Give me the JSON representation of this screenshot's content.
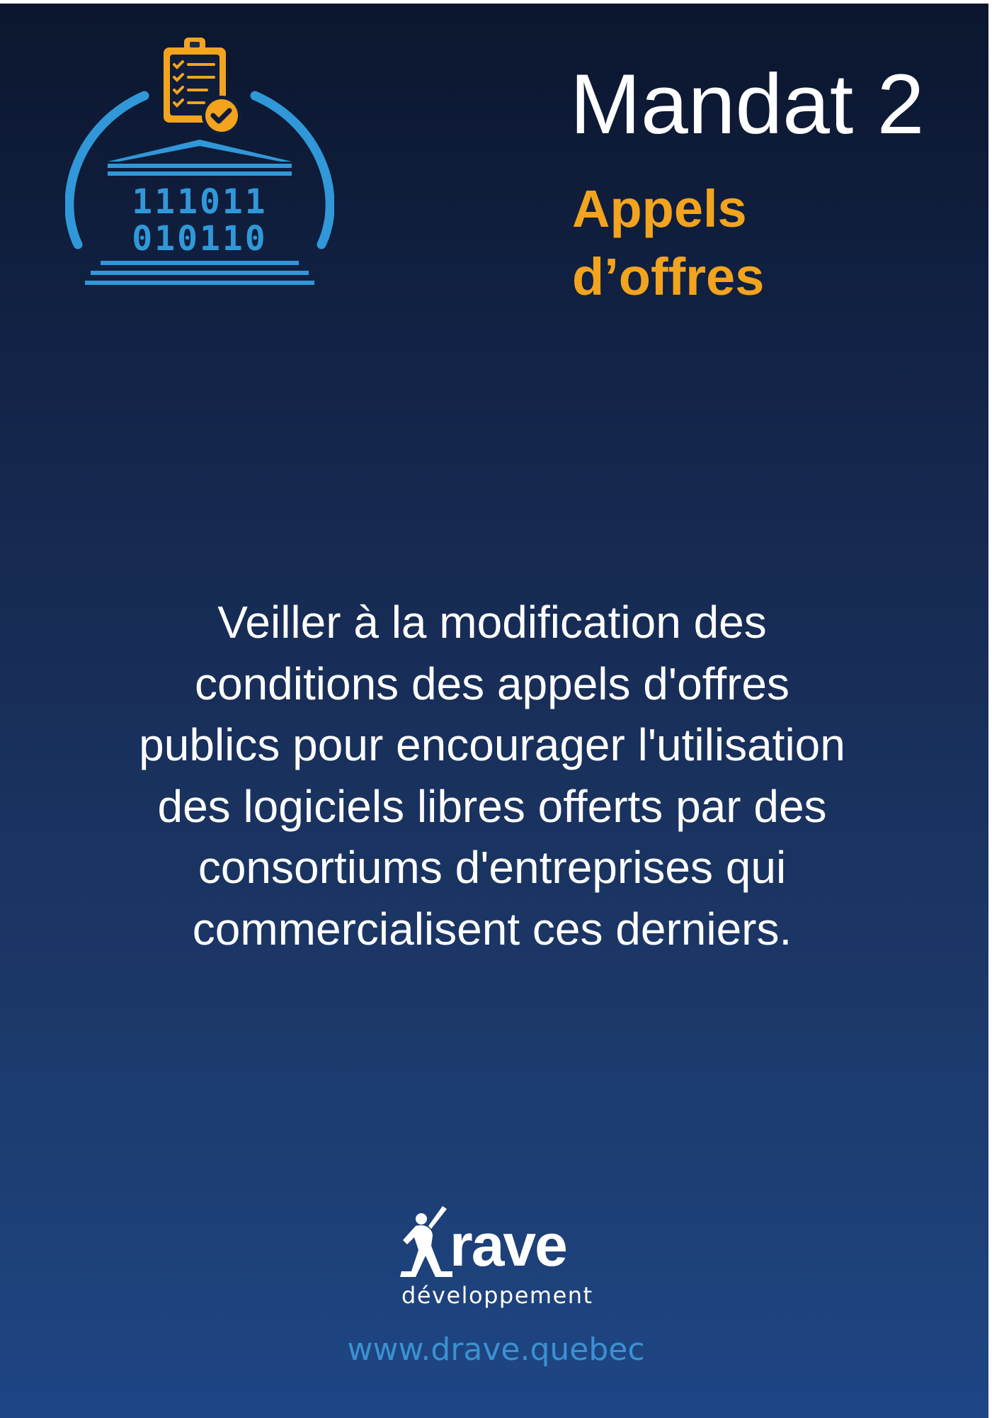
{
  "colors": {
    "background_top": "#0b162e",
    "background_bottom": "#1e4685",
    "accent_orange": "#f2a41e",
    "accent_blue": "#3098d8",
    "text": "#ffffff",
    "link": "#3b91d1"
  },
  "emblem": {
    "icons": [
      "clipboard-check-icon",
      "government-building-icon",
      "arc-frame-icon"
    ],
    "binary_lines": [
      "111011",
      "010110"
    ]
  },
  "header": {
    "title": "Mandat 2",
    "subtitle_lines": [
      "Appels",
      "d’offres"
    ]
  },
  "body": {
    "lines": [
      "Veiller à la modification des",
      "conditions des appels d'offres",
      "publics pour encourager l'utilisation",
      "des logiciels libres offerts par des",
      "consortiums d'entreprises qui",
      "commercialisent ces derniers."
    ]
  },
  "footer": {
    "logo_word": "rave",
    "logo_sub": "développement",
    "website": "www.drave.quebec"
  }
}
